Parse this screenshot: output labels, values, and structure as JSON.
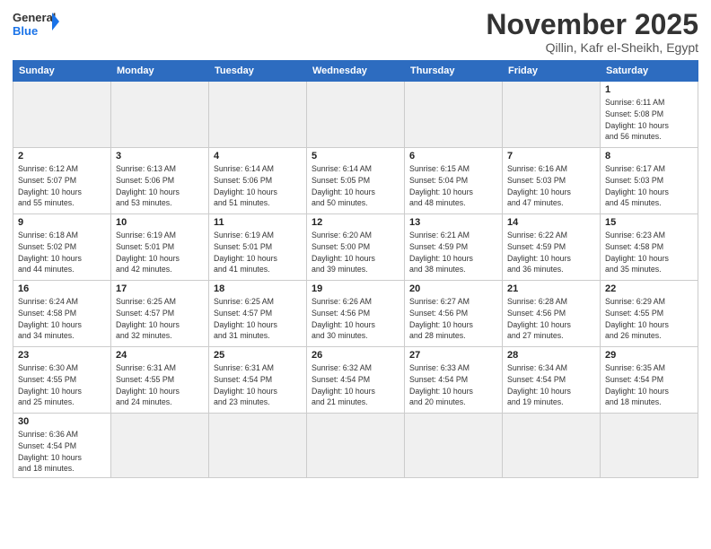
{
  "logo": {
    "text_general": "General",
    "text_blue": "Blue"
  },
  "title": "November 2025",
  "subtitle": "Qillin, Kafr el-Sheikh, Egypt",
  "weekdays": [
    "Sunday",
    "Monday",
    "Tuesday",
    "Wednesday",
    "Thursday",
    "Friday",
    "Saturday"
  ],
  "weeks": [
    [
      {
        "day": "",
        "info": "",
        "empty": true
      },
      {
        "day": "",
        "info": "",
        "empty": true
      },
      {
        "day": "",
        "info": "",
        "empty": true
      },
      {
        "day": "",
        "info": "",
        "empty": true
      },
      {
        "day": "",
        "info": "",
        "empty": true
      },
      {
        "day": "",
        "info": "",
        "empty": true
      },
      {
        "day": "1",
        "info": "Sunrise: 6:11 AM\nSunset: 5:08 PM\nDaylight: 10 hours\nand 56 minutes."
      }
    ],
    [
      {
        "day": "2",
        "info": "Sunrise: 6:12 AM\nSunset: 5:07 PM\nDaylight: 10 hours\nand 55 minutes."
      },
      {
        "day": "3",
        "info": "Sunrise: 6:13 AM\nSunset: 5:06 PM\nDaylight: 10 hours\nand 53 minutes."
      },
      {
        "day": "4",
        "info": "Sunrise: 6:14 AM\nSunset: 5:06 PM\nDaylight: 10 hours\nand 51 minutes."
      },
      {
        "day": "5",
        "info": "Sunrise: 6:14 AM\nSunset: 5:05 PM\nDaylight: 10 hours\nand 50 minutes."
      },
      {
        "day": "6",
        "info": "Sunrise: 6:15 AM\nSunset: 5:04 PM\nDaylight: 10 hours\nand 48 minutes."
      },
      {
        "day": "7",
        "info": "Sunrise: 6:16 AM\nSunset: 5:03 PM\nDaylight: 10 hours\nand 47 minutes."
      },
      {
        "day": "8",
        "info": "Sunrise: 6:17 AM\nSunset: 5:03 PM\nDaylight: 10 hours\nand 45 minutes."
      }
    ],
    [
      {
        "day": "9",
        "info": "Sunrise: 6:18 AM\nSunset: 5:02 PM\nDaylight: 10 hours\nand 44 minutes."
      },
      {
        "day": "10",
        "info": "Sunrise: 6:19 AM\nSunset: 5:01 PM\nDaylight: 10 hours\nand 42 minutes."
      },
      {
        "day": "11",
        "info": "Sunrise: 6:19 AM\nSunset: 5:01 PM\nDaylight: 10 hours\nand 41 minutes."
      },
      {
        "day": "12",
        "info": "Sunrise: 6:20 AM\nSunset: 5:00 PM\nDaylight: 10 hours\nand 39 minutes."
      },
      {
        "day": "13",
        "info": "Sunrise: 6:21 AM\nSunset: 4:59 PM\nDaylight: 10 hours\nand 38 minutes."
      },
      {
        "day": "14",
        "info": "Sunrise: 6:22 AM\nSunset: 4:59 PM\nDaylight: 10 hours\nand 36 minutes."
      },
      {
        "day": "15",
        "info": "Sunrise: 6:23 AM\nSunset: 4:58 PM\nDaylight: 10 hours\nand 35 minutes."
      }
    ],
    [
      {
        "day": "16",
        "info": "Sunrise: 6:24 AM\nSunset: 4:58 PM\nDaylight: 10 hours\nand 34 minutes."
      },
      {
        "day": "17",
        "info": "Sunrise: 6:25 AM\nSunset: 4:57 PM\nDaylight: 10 hours\nand 32 minutes."
      },
      {
        "day": "18",
        "info": "Sunrise: 6:25 AM\nSunset: 4:57 PM\nDaylight: 10 hours\nand 31 minutes."
      },
      {
        "day": "19",
        "info": "Sunrise: 6:26 AM\nSunset: 4:56 PM\nDaylight: 10 hours\nand 30 minutes."
      },
      {
        "day": "20",
        "info": "Sunrise: 6:27 AM\nSunset: 4:56 PM\nDaylight: 10 hours\nand 28 minutes."
      },
      {
        "day": "21",
        "info": "Sunrise: 6:28 AM\nSunset: 4:56 PM\nDaylight: 10 hours\nand 27 minutes."
      },
      {
        "day": "22",
        "info": "Sunrise: 6:29 AM\nSunset: 4:55 PM\nDaylight: 10 hours\nand 26 minutes."
      }
    ],
    [
      {
        "day": "23",
        "info": "Sunrise: 6:30 AM\nSunset: 4:55 PM\nDaylight: 10 hours\nand 25 minutes."
      },
      {
        "day": "24",
        "info": "Sunrise: 6:31 AM\nSunset: 4:55 PM\nDaylight: 10 hours\nand 24 minutes."
      },
      {
        "day": "25",
        "info": "Sunrise: 6:31 AM\nSunset: 4:54 PM\nDaylight: 10 hours\nand 23 minutes."
      },
      {
        "day": "26",
        "info": "Sunrise: 6:32 AM\nSunset: 4:54 PM\nDaylight: 10 hours\nand 21 minutes."
      },
      {
        "day": "27",
        "info": "Sunrise: 6:33 AM\nSunset: 4:54 PM\nDaylight: 10 hours\nand 20 minutes."
      },
      {
        "day": "28",
        "info": "Sunrise: 6:34 AM\nSunset: 4:54 PM\nDaylight: 10 hours\nand 19 minutes."
      },
      {
        "day": "29",
        "info": "Sunrise: 6:35 AM\nSunset: 4:54 PM\nDaylight: 10 hours\nand 18 minutes."
      }
    ],
    [
      {
        "day": "30",
        "info": "Sunrise: 6:36 AM\nSunset: 4:54 PM\nDaylight: 10 hours\nand 18 minutes.",
        "lastrow": true
      },
      {
        "day": "",
        "info": "",
        "empty": true,
        "lastrow": true
      },
      {
        "day": "",
        "info": "",
        "empty": true,
        "lastrow": true
      },
      {
        "day": "",
        "info": "",
        "empty": true,
        "lastrow": true
      },
      {
        "day": "",
        "info": "",
        "empty": true,
        "lastrow": true
      },
      {
        "day": "",
        "info": "",
        "empty": true,
        "lastrow": true
      },
      {
        "day": "",
        "info": "",
        "empty": true,
        "lastrow": true
      }
    ]
  ]
}
